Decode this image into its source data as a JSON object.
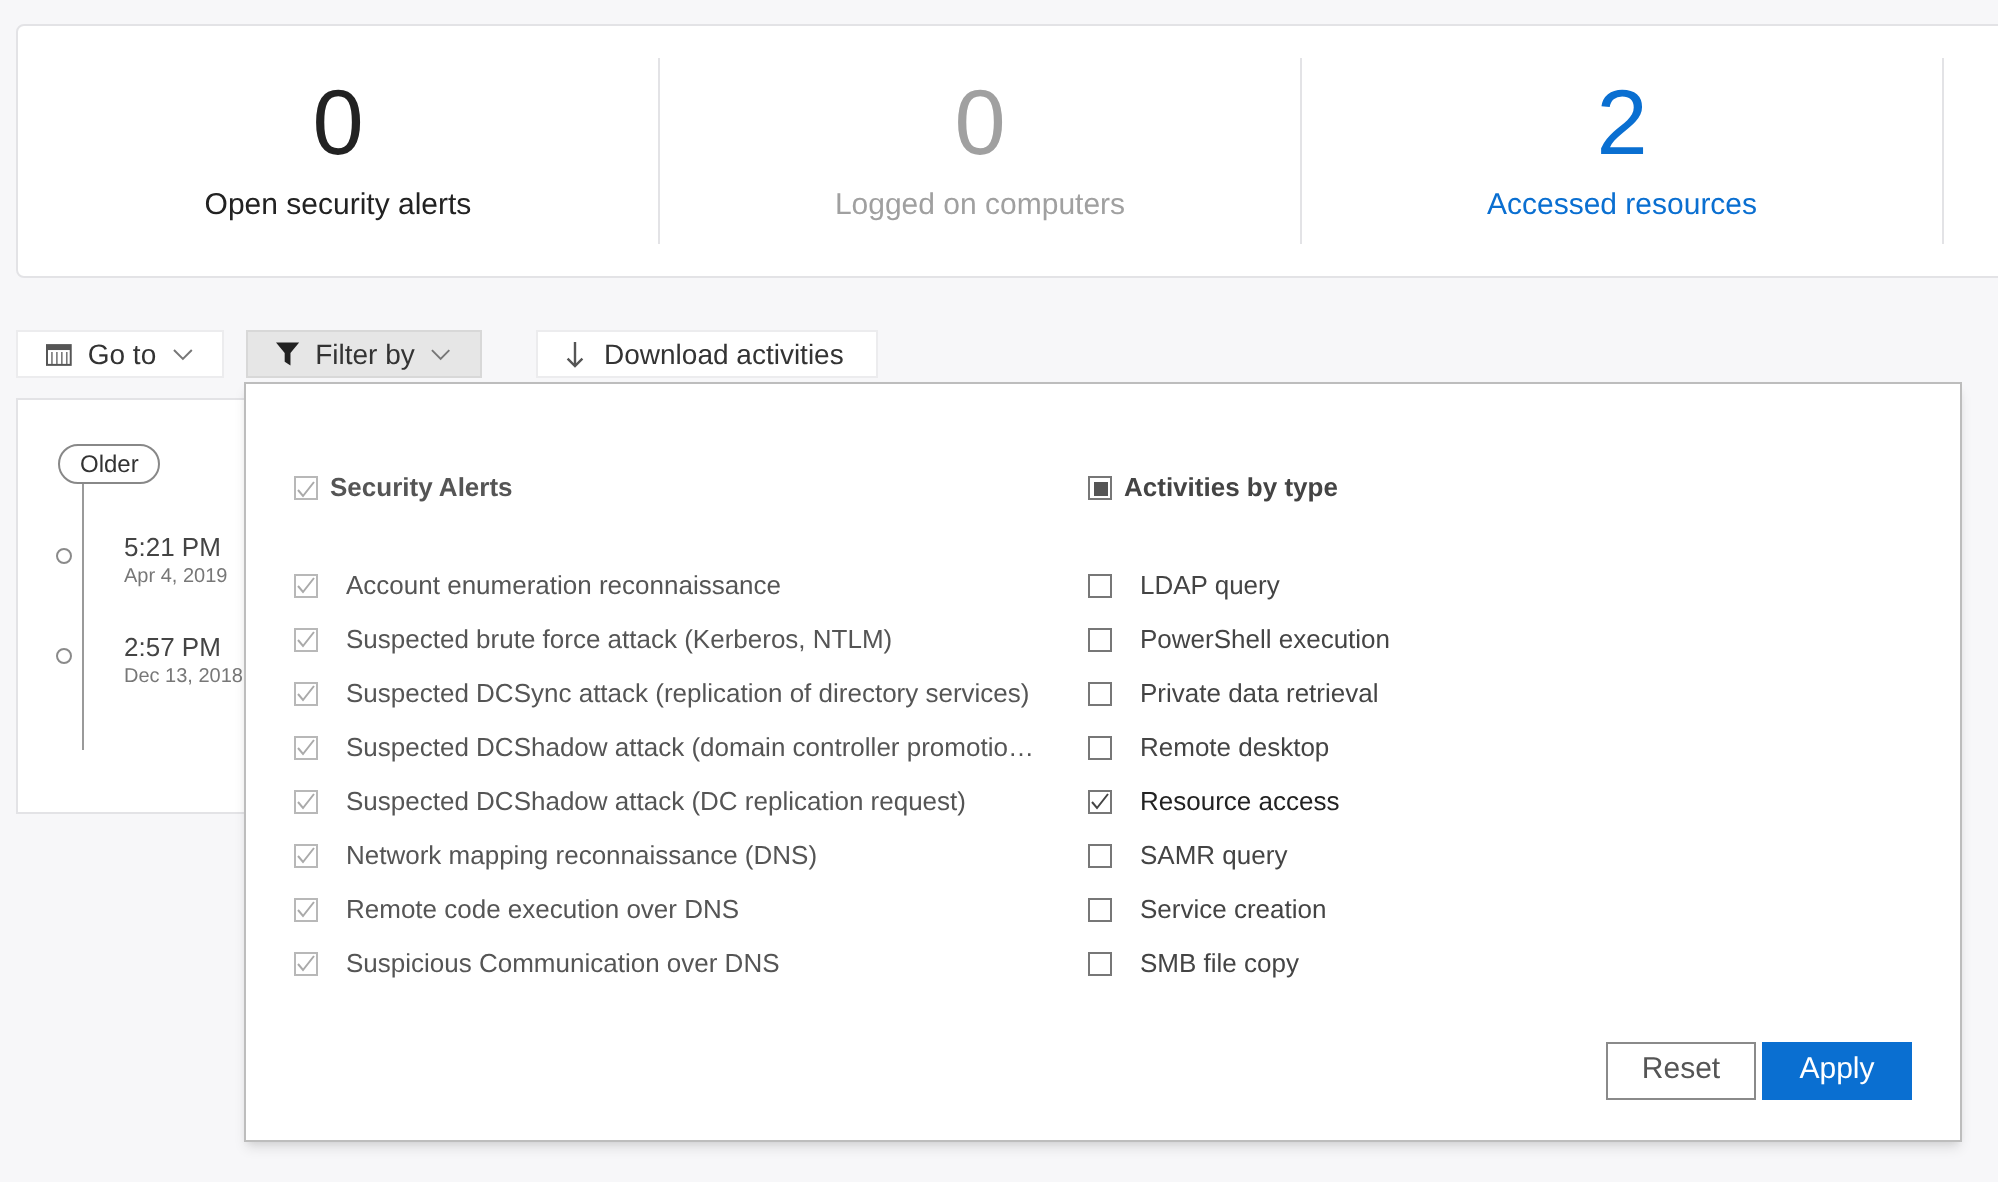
{
  "stats": [
    {
      "value": "0",
      "label": "Open security alerts",
      "kind": "normal"
    },
    {
      "value": "0",
      "label": "Logged on computers",
      "kind": "disabled"
    },
    {
      "value": "2",
      "label": "Accessed resources",
      "kind": "link"
    }
  ],
  "toolbar": {
    "goto": "Go to",
    "filter": "Filter by",
    "filter_open": true,
    "download": "Download activities"
  },
  "timeline": {
    "older": "Older",
    "events": [
      {
        "time": "5:21 PM",
        "date": "Apr 4, 2019"
      },
      {
        "time": "2:57 PM",
        "date": "Dec 13, 2018"
      }
    ]
  },
  "filter_panel": {
    "groups": [
      {
        "title": "Security Alerts",
        "checked": true,
        "indeterminate": false,
        "disabled": true,
        "items": [
          {
            "label": "Account enumeration reconnaissance",
            "checked": true
          },
          {
            "label": "Suspected brute force attack (Kerberos, NTLM)",
            "checked": true
          },
          {
            "label": "Suspected DCSync attack (replication of directory services)",
            "checked": true
          },
          {
            "label": "Suspected DCShadow attack (domain controller promotio…",
            "checked": true
          },
          {
            "label": "Suspected DCShadow attack (DC replication request)",
            "checked": true
          },
          {
            "label": "Network mapping reconnaissance (DNS)",
            "checked": true
          },
          {
            "label": "Remote code execution over DNS",
            "checked": true
          },
          {
            "label": "Suspicious Communication over DNS",
            "checked": true
          }
        ]
      },
      {
        "title": "Activities by type",
        "checked": false,
        "indeterminate": true,
        "disabled": false,
        "items": [
          {
            "label": "LDAP query",
            "checked": false
          },
          {
            "label": "PowerShell execution",
            "checked": false
          },
          {
            "label": "Private data retrieval",
            "checked": false
          },
          {
            "label": "Remote desktop",
            "checked": false
          },
          {
            "label": "Resource access",
            "checked": true
          },
          {
            "label": "SAMR query",
            "checked": false
          },
          {
            "label": "Service creation",
            "checked": false
          },
          {
            "label": "SMB file copy",
            "checked": false
          }
        ]
      }
    ],
    "buttons": {
      "reset": "Reset",
      "apply": "Apply"
    }
  }
}
